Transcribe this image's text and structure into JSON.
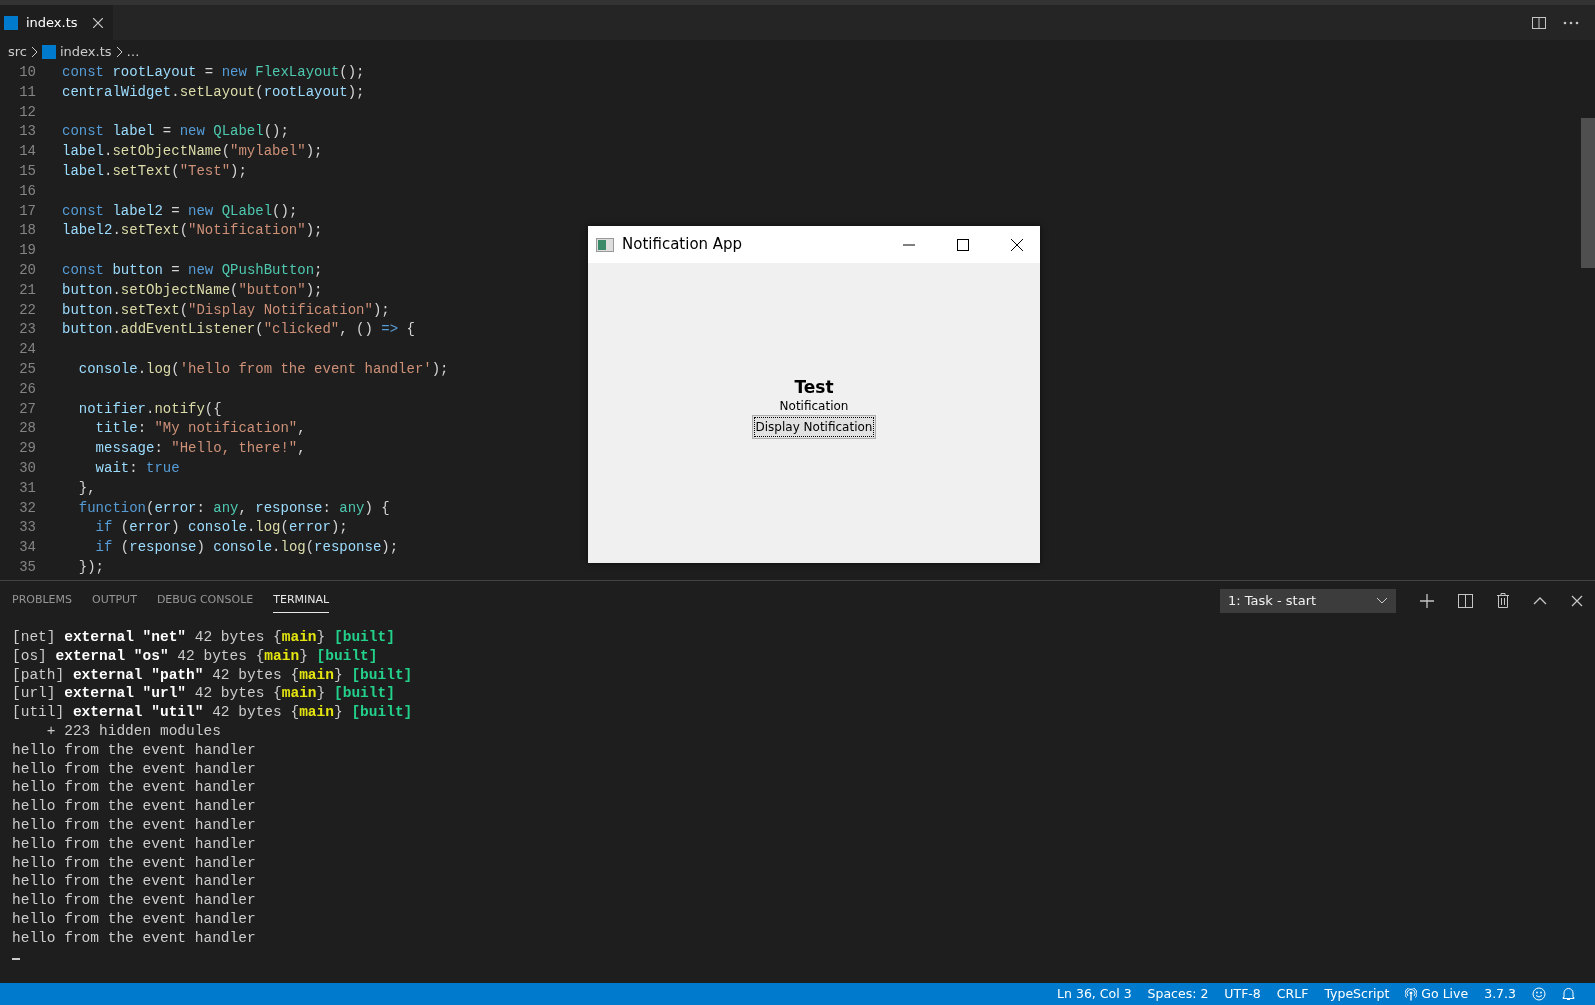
{
  "tabs": [
    {
      "label": "index.ts",
      "selected": true
    }
  ],
  "breadcrumb": [
    "src",
    "index.ts",
    "…"
  ],
  "code_lines": [
    {
      "number": "10",
      "tokens": [
        {
          "text": "const ",
          "kind": "keyword"
        },
        {
          "text": "rootLayout",
          "kind": "variable"
        },
        {
          "text": " = ",
          "kind": "plain"
        },
        {
          "text": "new ",
          "kind": "keyword"
        },
        {
          "text": "FlexLayout",
          "kind": "type"
        },
        {
          "text": "();",
          "kind": "plain"
        }
      ]
    },
    {
      "number": "11",
      "tokens": [
        {
          "text": "centralWidget",
          "kind": "variable"
        },
        {
          "text": ".",
          "kind": "plain"
        },
        {
          "text": "setLayout",
          "kind": "function"
        },
        {
          "text": "(",
          "kind": "plain"
        },
        {
          "text": "rootLayout",
          "kind": "variable"
        },
        {
          "text": ");",
          "kind": "plain"
        }
      ]
    },
    {
      "number": "12"
    },
    {
      "number": "13",
      "tokens": [
        {
          "text": "const ",
          "kind": "keyword"
        },
        {
          "text": "label",
          "kind": "variable"
        },
        {
          "text": " = ",
          "kind": "plain"
        },
        {
          "text": "new ",
          "kind": "keyword"
        },
        {
          "text": "QLabel",
          "kind": "type"
        },
        {
          "text": "();",
          "kind": "plain"
        }
      ]
    },
    {
      "number": "14",
      "tokens": [
        {
          "text": "label",
          "kind": "variable"
        },
        {
          "text": ".",
          "kind": "plain"
        },
        {
          "text": "setObjectName",
          "kind": "function"
        },
        {
          "text": "(",
          "kind": "plain"
        },
        {
          "text": "\"mylabel\"",
          "kind": "string"
        },
        {
          "text": ");",
          "kind": "plain"
        }
      ]
    },
    {
      "number": "15",
      "tokens": [
        {
          "text": "label",
          "kind": "variable"
        },
        {
          "text": ".",
          "kind": "plain"
        },
        {
          "text": "setText",
          "kind": "function"
        },
        {
          "text": "(",
          "kind": "plain"
        },
        {
          "text": "\"Test\"",
          "kind": "string"
        },
        {
          "text": ");",
          "kind": "plain"
        }
      ]
    },
    {
      "number": "16"
    },
    {
      "number": "17",
      "tokens": [
        {
          "text": "const ",
          "kind": "keyword"
        },
        {
          "text": "label2",
          "kind": "variable"
        },
        {
          "text": " = ",
          "kind": "plain"
        },
        {
          "text": "new ",
          "kind": "keyword"
        },
        {
          "text": "QLabel",
          "kind": "type"
        },
        {
          "text": "();",
          "kind": "plain"
        }
      ]
    },
    {
      "number": "18",
      "tokens": [
        {
          "text": "label2",
          "kind": "variable"
        },
        {
          "text": ".",
          "kind": "plain"
        },
        {
          "text": "setText",
          "kind": "function"
        },
        {
          "text": "(",
          "kind": "plain"
        },
        {
          "text": "\"Notification\"",
          "kind": "string"
        },
        {
          "text": ");",
          "kind": "plain"
        }
      ]
    },
    {
      "number": "19"
    },
    {
      "number": "20",
      "tokens": [
        {
          "text": "const ",
          "kind": "keyword"
        },
        {
          "text": "button",
          "kind": "variable"
        },
        {
          "text": " = ",
          "kind": "plain"
        },
        {
          "text": "new ",
          "kind": "keyword"
        },
        {
          "text": "QPushButton",
          "kind": "type"
        },
        {
          "text": ";",
          "kind": "plain"
        }
      ]
    },
    {
      "number": "21",
      "tokens": [
        {
          "text": "button",
          "kind": "variable"
        },
        {
          "text": ".",
          "kind": "plain"
        },
        {
          "text": "setObjectName",
          "kind": "function"
        },
        {
          "text": "(",
          "kind": "plain"
        },
        {
          "text": "\"button\"",
          "kind": "string"
        },
        {
          "text": ");",
          "kind": "plain"
        }
      ]
    },
    {
      "number": "22",
      "tokens": [
        {
          "text": "button",
          "kind": "variable"
        },
        {
          "text": ".",
          "kind": "plain"
        },
        {
          "text": "setText",
          "kind": "function"
        },
        {
          "text": "(",
          "kind": "plain"
        },
        {
          "text": "\"Display Notification\"",
          "kind": "string"
        },
        {
          "text": ");",
          "kind": "plain"
        }
      ]
    },
    {
      "number": "23",
      "tokens": [
        {
          "text": "button",
          "kind": "variable"
        },
        {
          "text": ".",
          "kind": "plain"
        },
        {
          "text": "addEventListener",
          "kind": "function"
        },
        {
          "text": "(",
          "kind": "plain"
        },
        {
          "text": "\"clicked\"",
          "kind": "string"
        },
        {
          "text": ", () ",
          "kind": "plain"
        },
        {
          "text": "=>",
          "kind": "keyword"
        },
        {
          "text": " {",
          "kind": "plain"
        }
      ]
    },
    {
      "number": "24"
    },
    {
      "number": "25",
      "tokens": [
        {
          "text": "  console",
          "kind": "variable"
        },
        {
          "text": ".",
          "kind": "plain"
        },
        {
          "text": "log",
          "kind": "function"
        },
        {
          "text": "(",
          "kind": "plain"
        },
        {
          "text": "'hello from the event handler'",
          "kind": "string"
        },
        {
          "text": ");",
          "kind": "plain"
        }
      ]
    },
    {
      "number": "26"
    },
    {
      "number": "27",
      "tokens": [
        {
          "text": "  notifier",
          "kind": "variable"
        },
        {
          "text": ".",
          "kind": "plain"
        },
        {
          "text": "notify",
          "kind": "function"
        },
        {
          "text": "({",
          "kind": "plain"
        }
      ]
    },
    {
      "number": "28",
      "tokens": [
        {
          "text": "    title",
          "kind": "variable"
        },
        {
          "text": ": ",
          "kind": "plain"
        },
        {
          "text": "\"My notification\"",
          "kind": "string"
        },
        {
          "text": ",",
          "kind": "plain"
        }
      ]
    },
    {
      "number": "29",
      "tokens": [
        {
          "text": "    message",
          "kind": "variable"
        },
        {
          "text": ": ",
          "kind": "plain"
        },
        {
          "text": "\"Hello, there!\"",
          "kind": "string"
        },
        {
          "text": ",",
          "kind": "plain"
        }
      ]
    },
    {
      "number": "30",
      "tokens": [
        {
          "text": "    wait",
          "kind": "variable"
        },
        {
          "text": ": ",
          "kind": "plain"
        },
        {
          "text": "true",
          "kind": "keyword"
        }
      ]
    },
    {
      "number": "31",
      "tokens": [
        {
          "text": "  },",
          "kind": "plain"
        }
      ]
    },
    {
      "number": "32",
      "tokens": [
        {
          "text": "  function",
          "kind": "keyword"
        },
        {
          "text": "(",
          "kind": "plain"
        },
        {
          "text": "error",
          "kind": "variable"
        },
        {
          "text": ": ",
          "kind": "plain"
        },
        {
          "text": "any",
          "kind": "type"
        },
        {
          "text": ", ",
          "kind": "plain"
        },
        {
          "text": "response",
          "kind": "variable"
        },
        {
          "text": ": ",
          "kind": "plain"
        },
        {
          "text": "any",
          "kind": "type"
        },
        {
          "text": ") {",
          "kind": "plain"
        }
      ]
    },
    {
      "number": "33",
      "tokens": [
        {
          "text": "    if",
          "kind": "keyword"
        },
        {
          "text": " (",
          "kind": "plain"
        },
        {
          "text": "error",
          "kind": "variable"
        },
        {
          "text": ") ",
          "kind": "plain"
        },
        {
          "text": "console",
          "kind": "variable"
        },
        {
          "text": ".",
          "kind": "plain"
        },
        {
          "text": "log",
          "kind": "function"
        },
        {
          "text": "(",
          "kind": "plain"
        },
        {
          "text": "error",
          "kind": "variable"
        },
        {
          "text": ");",
          "kind": "plain"
        }
      ]
    },
    {
      "number": "34",
      "tokens": [
        {
          "text": "    if",
          "kind": "keyword"
        },
        {
          "text": " (",
          "kind": "plain"
        },
        {
          "text": "response",
          "kind": "variable"
        },
        {
          "text": ") ",
          "kind": "plain"
        },
        {
          "text": "console",
          "kind": "variable"
        },
        {
          "text": ".",
          "kind": "plain"
        },
        {
          "text": "log",
          "kind": "function"
        },
        {
          "text": "(",
          "kind": "plain"
        },
        {
          "text": "response",
          "kind": "variable"
        },
        {
          "text": ");",
          "kind": "plain"
        }
      ]
    },
    {
      "number": "35",
      "tokens": [
        {
          "text": "  });",
          "kind": "plain"
        }
      ]
    }
  ],
  "app_window": {
    "title": "Notification App",
    "label": "Test",
    "label2": "Notification",
    "button": "Display Notification"
  },
  "panel_tabs": [
    {
      "label": "PROBLEMS",
      "selected": false
    },
    {
      "label": "OUTPUT",
      "selected": false
    },
    {
      "label": "DEBUG CONSOLE",
      "selected": false
    },
    {
      "label": "TERMINAL",
      "selected": true
    }
  ],
  "terminal_select": {
    "value": "1: Task - start"
  },
  "terminal_lines": [
    [
      {
        "text": "[net] ",
        "kind": "plain"
      },
      {
        "text": "external \"net\"",
        "kind": "bold"
      },
      {
        "text": " 42 bytes {",
        "kind": "plain"
      },
      {
        "text": "main",
        "kind": "yellow"
      },
      {
        "text": "} ",
        "kind": "plain"
      },
      {
        "text": "[built]",
        "kind": "green"
      }
    ],
    [
      {
        "text": "[os] ",
        "kind": "plain"
      },
      {
        "text": "external \"os\"",
        "kind": "bold"
      },
      {
        "text": " 42 bytes {",
        "kind": "plain"
      },
      {
        "text": "main",
        "kind": "yellow"
      },
      {
        "text": "} ",
        "kind": "plain"
      },
      {
        "text": "[built]",
        "kind": "green"
      }
    ],
    [
      {
        "text": "[path] ",
        "kind": "plain"
      },
      {
        "text": "external \"path\"",
        "kind": "bold"
      },
      {
        "text": " 42 bytes {",
        "kind": "plain"
      },
      {
        "text": "main",
        "kind": "yellow"
      },
      {
        "text": "} ",
        "kind": "plain"
      },
      {
        "text": "[built]",
        "kind": "green"
      }
    ],
    [
      {
        "text": "[url] ",
        "kind": "plain"
      },
      {
        "text": "external \"url\"",
        "kind": "bold"
      },
      {
        "text": " 42 bytes {",
        "kind": "plain"
      },
      {
        "text": "main",
        "kind": "yellow"
      },
      {
        "text": "} ",
        "kind": "plain"
      },
      {
        "text": "[built]",
        "kind": "green"
      }
    ],
    [
      {
        "text": "[util] ",
        "kind": "plain"
      },
      {
        "text": "external \"util\"",
        "kind": "bold"
      },
      {
        "text": " 42 bytes {",
        "kind": "plain"
      },
      {
        "text": "main",
        "kind": "yellow"
      },
      {
        "text": "} ",
        "kind": "plain"
      },
      {
        "text": "[built]",
        "kind": "green"
      }
    ],
    [
      {
        "text": "    + 223 hidden modules",
        "kind": "plain"
      }
    ],
    [
      {
        "text": "hello from the event handler",
        "kind": "plain"
      }
    ],
    [
      {
        "text": "hello from the event handler",
        "kind": "plain"
      }
    ],
    [
      {
        "text": "hello from the event handler",
        "kind": "plain"
      }
    ],
    [
      {
        "text": "hello from the event handler",
        "kind": "plain"
      }
    ],
    [
      {
        "text": "hello from the event handler",
        "kind": "plain"
      }
    ],
    [
      {
        "text": "hello from the event handler",
        "kind": "plain"
      }
    ],
    [
      {
        "text": "hello from the event handler",
        "kind": "plain"
      }
    ],
    [
      {
        "text": "hello from the event handler",
        "kind": "plain"
      }
    ],
    [
      {
        "text": "hello from the event handler",
        "kind": "plain"
      }
    ],
    [
      {
        "text": "hello from the event handler",
        "kind": "plain"
      }
    ],
    [
      {
        "text": "hello from the event handler",
        "kind": "plain"
      }
    ]
  ],
  "status_bar": {
    "position": "Ln 36, Col 3",
    "spaces": "Spaces: 2",
    "encoding": "UTF-8",
    "line_ending": "CRLF",
    "language": "TypeScript",
    "live": "Go Live",
    "version": "3.7.3"
  }
}
